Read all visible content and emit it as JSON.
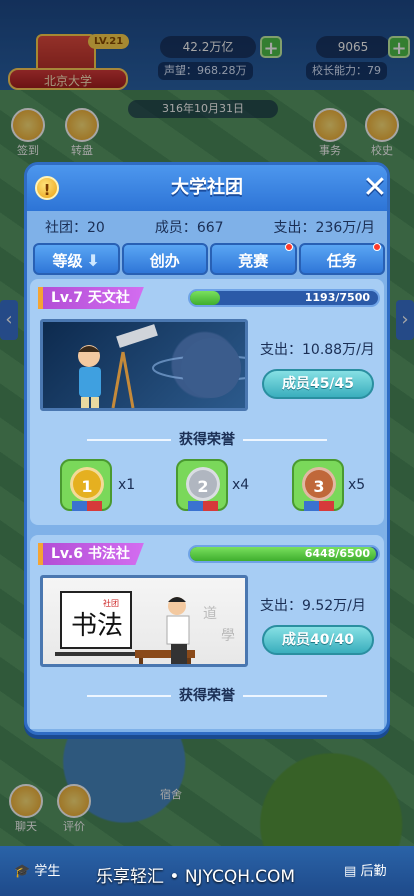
{
  "hud": {
    "school_name": "北京大学",
    "school_level": "LV.21",
    "money": "42.2万亿",
    "diamonds": "9065",
    "reputation_label": "声望：",
    "reputation_value": "968.28万",
    "principal_label": "校长能力：",
    "principal_value": "79",
    "date": "316年10月31日",
    "checkin": "签到",
    "spin": "转盘",
    "affairs": "事务",
    "school_history": "校史",
    "chat": "聊天",
    "review": "评价",
    "dorm": "宿舍"
  },
  "panel": {
    "title": "大学社团",
    "info": "!",
    "close": "✕",
    "stats": {
      "clubs_label": "社团：",
      "clubs_value": "20",
      "members_label": "成员：",
      "members_value": "667",
      "expense_label": "支出：",
      "expense_value": "236万/月"
    },
    "tabs": [
      {
        "label": "等级",
        "arrow": "⬇"
      },
      {
        "label": "创办"
      },
      {
        "label": "竞赛"
      },
      {
        "label": "任务"
      }
    ],
    "clubs": [
      {
        "tag": "Lv.7  天文社",
        "progress": 0.159,
        "progress_text": "1193/7500",
        "expense": "支出：10.88万/月",
        "members_btn": "成员45/45",
        "honor_title": "获得荣誉",
        "medals": [
          {
            "rank": "1",
            "count": "x1",
            "color": "#e5b020"
          },
          {
            "rank": "2",
            "count": "x4",
            "color": "#b0b6c0"
          },
          {
            "rank": "3",
            "count": "x5",
            "color": "#c0683a"
          }
        ]
      },
      {
        "tag": "Lv.6  书法社",
        "progress": 0.992,
        "progress_text": "6448/6500",
        "expense": "支出：9.52万/月",
        "members_btn": "成员40/40",
        "honor_title": "获得荣誉",
        "photo_logo": "书法",
        "photo_logo_small": "社团"
      }
    ]
  },
  "bottom": {
    "students": "学生",
    "logistics": "后勤",
    "watermark": "乐享轻汇 • NJYCQH.COM"
  }
}
